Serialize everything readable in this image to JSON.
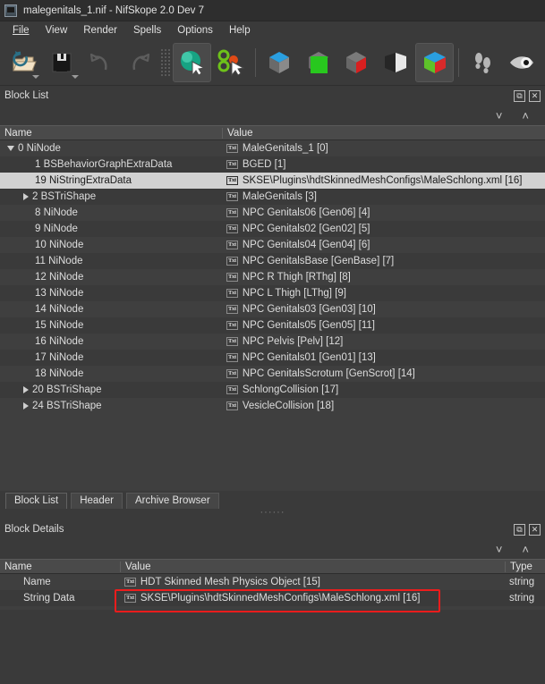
{
  "window": {
    "title": "malegenitals_1.nif - NifSkope 2.0 Dev 7",
    "icon": "app-icon"
  },
  "menubar": {
    "items": [
      {
        "label": "File",
        "accel": "F"
      },
      {
        "label": "View",
        "accel": "V"
      },
      {
        "label": "Render",
        "accel": "R"
      },
      {
        "label": "Spells",
        "accel": "S"
      },
      {
        "label": "Options",
        "accel": "O"
      },
      {
        "label": "Help",
        "accel": "H"
      }
    ]
  },
  "toolbar": {
    "buttons": [
      {
        "name": "open-file-button",
        "icon": "folder-open-icon",
        "has_menu": true,
        "active": false
      },
      {
        "name": "save-file-button",
        "icon": "floppy-save-icon",
        "has_menu": true,
        "active": false
      },
      {
        "name": "undo-button",
        "icon": "undo-arrow-icon",
        "has_menu": false,
        "active": false,
        "disabled": true
      },
      {
        "name": "redo-button",
        "icon": "redo-arrow-icon",
        "has_menu": false,
        "active": false,
        "disabled": true
      },
      {
        "name": "drag-handle",
        "icon": "grip-dots-icon",
        "has_menu": false,
        "active": false
      },
      {
        "name": "select-object-button",
        "icon": "green-sphere-cursor-icon",
        "has_menu": false,
        "active": true
      },
      {
        "name": "select-vertex-button",
        "icon": "rings-cursor-icon",
        "has_menu": false,
        "active": false
      },
      {
        "name": "view-top-button",
        "icon": "cube-blue-top-icon",
        "has_menu": false,
        "active": false
      },
      {
        "name": "view-front-button",
        "icon": "cube-green-front-icon",
        "has_menu": false,
        "active": false
      },
      {
        "name": "view-side-button",
        "icon": "cube-red-side-icon",
        "has_menu": false,
        "active": false
      },
      {
        "name": "flip-view-button",
        "icon": "flip-page-icon",
        "has_menu": false,
        "active": false
      },
      {
        "name": "view-perspective-button",
        "icon": "cube-rgb-corner-icon",
        "has_menu": false,
        "active": true
      },
      {
        "name": "walk-mode-button",
        "icon": "footprints-icon",
        "has_menu": false,
        "active": false
      },
      {
        "name": "visibility-button",
        "icon": "eye-icon",
        "has_menu": false,
        "active": false
      }
    ]
  },
  "block_list_panel": {
    "title": "Block List",
    "float_label": "⧉",
    "close_label": "✕",
    "expand_all_label": "˅",
    "collapse_all_label": "˄",
    "columns": [
      "Name",
      "Value"
    ],
    "rows": [
      {
        "indent": 0,
        "arrow": "down",
        "name": "0 NiNode",
        "value": "MaleGenitals_1 [0]",
        "selected": false
      },
      {
        "indent": 1,
        "arrow": "none",
        "name": "1 BSBehaviorGraphExtraData",
        "value": "BGED [1]",
        "selected": false
      },
      {
        "indent": 1,
        "arrow": "none",
        "name": "19 NiStringExtraData",
        "value": "SKSE\\Plugins\\hdtSkinnedMeshConfigs\\MaleSchlong.xml [16]",
        "selected": true
      },
      {
        "indent": 1,
        "arrow": "right",
        "name": "2 BSTriShape",
        "value": "MaleGenitals [3]",
        "selected": false
      },
      {
        "indent": 1,
        "arrow": "none",
        "name": "8 NiNode",
        "value": "NPC Genitals06 [Gen06] [4]",
        "selected": false
      },
      {
        "indent": 1,
        "arrow": "none",
        "name": "9 NiNode",
        "value": "NPC Genitals02 [Gen02] [5]",
        "selected": false
      },
      {
        "indent": 1,
        "arrow": "none",
        "name": "10 NiNode",
        "value": "NPC Genitals04 [Gen04] [6]",
        "selected": false
      },
      {
        "indent": 1,
        "arrow": "none",
        "name": "11 NiNode",
        "value": "NPC GenitalsBase [GenBase] [7]",
        "selected": false
      },
      {
        "indent": 1,
        "arrow": "none",
        "name": "12 NiNode",
        "value": "NPC R Thigh [RThg] [8]",
        "selected": false
      },
      {
        "indent": 1,
        "arrow": "none",
        "name": "13 NiNode",
        "value": "NPC L Thigh [LThg] [9]",
        "selected": false
      },
      {
        "indent": 1,
        "arrow": "none",
        "name": "14 NiNode",
        "value": "NPC Genitals03 [Gen03] [10]",
        "selected": false
      },
      {
        "indent": 1,
        "arrow": "none",
        "name": "15 NiNode",
        "value": "NPC Genitals05 [Gen05] [11]",
        "selected": false
      },
      {
        "indent": 1,
        "arrow": "none",
        "name": "16 NiNode",
        "value": "NPC Pelvis [Pelv] [12]",
        "selected": false
      },
      {
        "indent": 1,
        "arrow": "none",
        "name": "17 NiNode",
        "value": "NPC Genitals01 [Gen01] [13]",
        "selected": false
      },
      {
        "indent": 1,
        "arrow": "none",
        "name": "18 NiNode",
        "value": "NPC GenitalsScrotum [GenScrot] [14]",
        "selected": false
      },
      {
        "indent": 1,
        "arrow": "right",
        "name": "20 BSTriShape",
        "value": "SchlongCollision [17]",
        "selected": false
      },
      {
        "indent": 1,
        "arrow": "right",
        "name": "24 BSTriShape",
        "value": "VesicleCollision [18]",
        "selected": false
      }
    ]
  },
  "tabs": [
    {
      "label": "Block List",
      "active": true
    },
    {
      "label": "Header",
      "active": false
    },
    {
      "label": "Archive Browser",
      "active": false
    }
  ],
  "splitter": {
    "grip": "······"
  },
  "block_details_panel": {
    "title": "Block Details",
    "float_label": "⧉",
    "close_label": "✕",
    "expand_all_label": "˅",
    "collapse_all_label": "˄",
    "columns": [
      "Name",
      "Value",
      "Type"
    ],
    "rows": [
      {
        "name": "Name",
        "value": "HDT Skinned Mesh Physics Object [15]",
        "type": "string",
        "highlighted": false
      },
      {
        "name": "String Data",
        "value": "SKSE\\Plugins\\hdtSkinnedMeshConfigs\\MaleSchlong.xml [16]",
        "type": "string",
        "highlighted": true
      }
    ]
  },
  "annotation": {
    "highlight_color": "#ee1c1c",
    "target": "String Data value cell"
  },
  "colors": {
    "window_bg": "#3a3a3a",
    "tree_bg": "#3f3f3f",
    "row_alt": "#3a3a3a",
    "header_bg": "#4a4a4a",
    "selection_bg": "#d2d2d2",
    "text": "#dddddd",
    "accent_red": "#ee1c1c"
  }
}
